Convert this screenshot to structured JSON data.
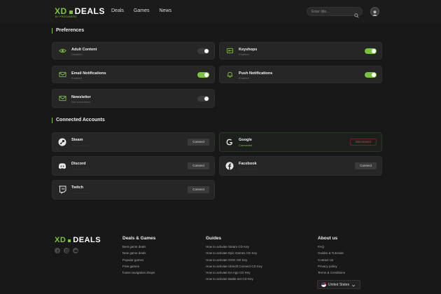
{
  "header": {
    "logo": {
      "left": "XD",
      "right": "DEALS",
      "tagline": "BY PROGAMERS"
    },
    "nav": [
      "Deals",
      "Games",
      "News"
    ],
    "search": {
      "placeholder": "Enter title..."
    }
  },
  "preferences": {
    "title": "Preferences",
    "items": [
      {
        "name": "Adult Content",
        "status": "Disabled",
        "icon": "eye-icon",
        "enabled": false
      },
      {
        "name": "Keyshops",
        "status": "Enabled",
        "icon": "key-icon",
        "enabled": true
      },
      {
        "name": "Email Notifications",
        "status": "Enabled",
        "icon": "envelope-icon",
        "enabled": true
      },
      {
        "name": "Push Notifications",
        "status": "Enabled",
        "icon": "bell-icon",
        "enabled": true
      },
      {
        "name": "Newsletter",
        "status": "Not subscribed",
        "icon": "envelope-icon",
        "enabled": false
      }
    ]
  },
  "accounts": {
    "title": "Connected Accounts",
    "items": [
      {
        "name": "Steam",
        "status": "Not connected",
        "action": "Connect",
        "icon": "steam-icon"
      },
      {
        "name": "Google",
        "status": "Connected",
        "action": "Disconnect",
        "icon": "google-icon"
      },
      {
        "name": "Discord",
        "status": "Not connected",
        "action": "Connect",
        "icon": "discord-icon"
      },
      {
        "name": "Facebook",
        "status": "Not connected",
        "action": "Connect",
        "icon": "facebook-icon"
      },
      {
        "name": "Twitch",
        "status": "Not connected",
        "action": "Connect",
        "icon": "twitch-icon"
      }
    ]
  },
  "footer": {
    "logo": {
      "left": "XD",
      "right": "DEALS"
    },
    "socials": [
      "facebook-icon",
      "instagram-icon",
      "youtube-icon"
    ],
    "columns": [
      {
        "title": "Deals & Games",
        "links": [
          "Best game deals",
          "New game deals",
          "Popular games",
          "Free games",
          "footer.navigation.shops"
        ]
      },
      {
        "title": "Guides",
        "links": [
          "How to activate Steam CD Key",
          "How to activate Epic Games CD Key",
          "How to activate GOG CD Key",
          "How to activate Ubisoft Connect CD Key",
          "How to activate EA App CD Key",
          "How to activate Battle.net CD Key"
        ]
      },
      {
        "title": "About us",
        "links": [
          "FAQ",
          "Guides & Tutorials",
          "Contact Us",
          "Privacy policy",
          "Terms & Conditions"
        ]
      }
    ],
    "country": "United States"
  },
  "colors": {
    "accent": "#7bc43a",
    "danger": "#e04545",
    "background": "#181818",
    "card": "#262626"
  }
}
